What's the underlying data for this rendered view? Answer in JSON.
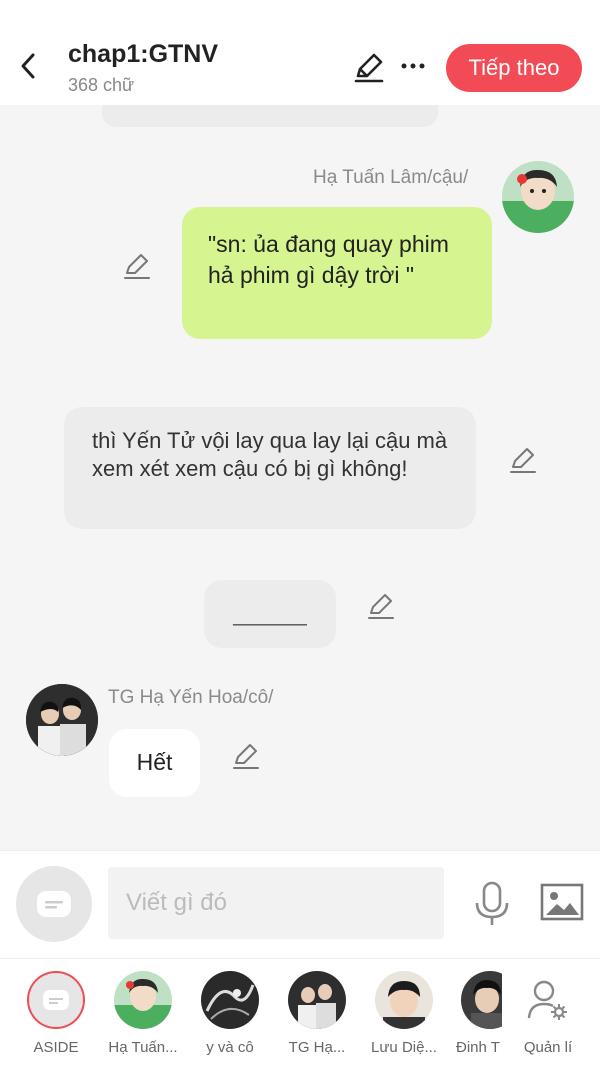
{
  "header": {
    "title": "chap1:GTNV",
    "word_count": "368 chữ",
    "next_label": "Tiếp theo"
  },
  "messages": [
    {
      "type": "right",
      "speaker": "Hạ Tuấn Lâm/cậu/",
      "text": "\"sn: ủa đang quay phim hả phim gì dậy trời \""
    },
    {
      "type": "narration",
      "text": "thì Yến Tử vội lay qua lay lại cậu mà xem xét xem cậu có bị gì không!"
    },
    {
      "type": "narration",
      "text": "______"
    },
    {
      "type": "left",
      "speaker": "TG Hạ Yến Hoa/cô/",
      "text": "Hết"
    }
  ],
  "composer": {
    "placeholder": "Viết gì đó"
  },
  "characters": [
    {
      "label": "ASIDE"
    },
    {
      "label": "Hạ Tuấn..."
    },
    {
      "label": "y và cô"
    },
    {
      "label": "TG Hạ..."
    },
    {
      "label": "Lưu Diệ..."
    },
    {
      "label": "Đinh T"
    },
    {
      "label": "Quản lí"
    }
  ],
  "colors": {
    "accent": "#f24b56",
    "right_bubble": "#d6f590",
    "narration_bubble": "#ececec"
  }
}
